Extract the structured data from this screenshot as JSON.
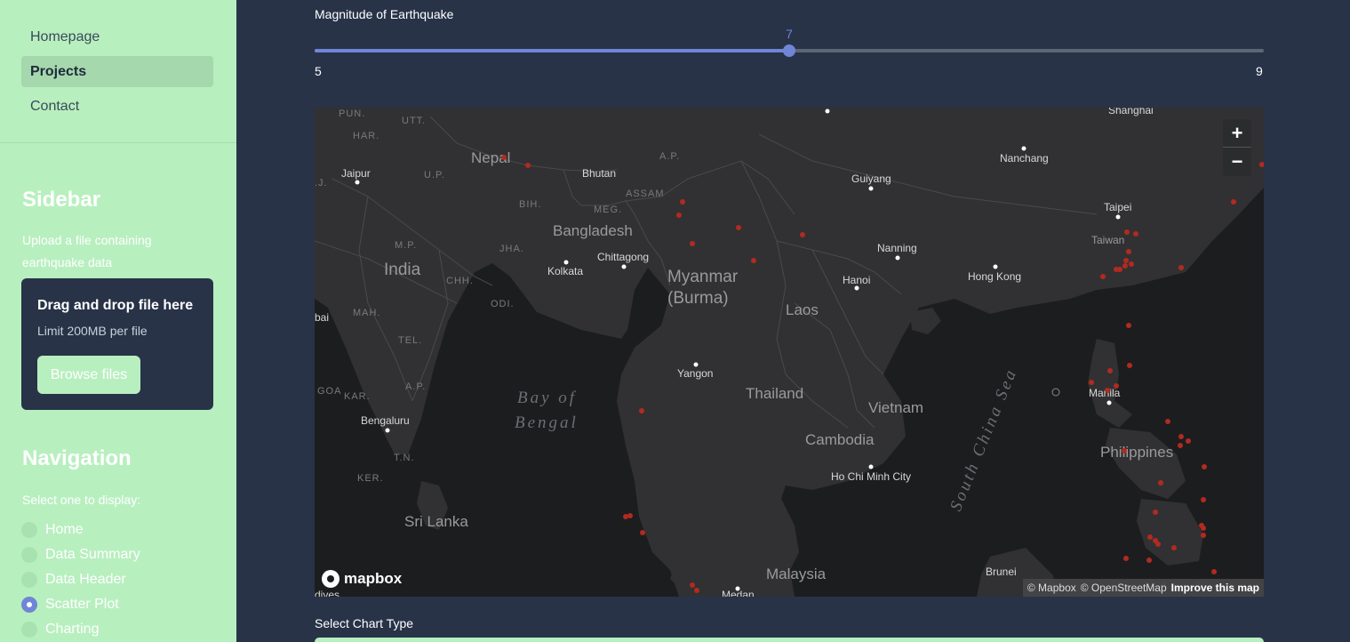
{
  "nav": {
    "items": [
      {
        "label": "Homepage",
        "active": false
      },
      {
        "label": "Projects",
        "active": true
      },
      {
        "label": "Contact",
        "active": false
      }
    ]
  },
  "sidebar": {
    "title": "Sidebar",
    "upload_prompt": "Upload a file containing earthquake data",
    "uploader": {
      "drag_text": "Drag and drop file here",
      "limit_text": "Limit 200MB per file",
      "browse_label": "Browse files"
    },
    "navigation_title": "Navigation",
    "select_prompt": "Select one to display:",
    "options": [
      {
        "label": "Home",
        "selected": false
      },
      {
        "label": "Data Summary",
        "selected": false
      },
      {
        "label": "Data Header",
        "selected": false
      },
      {
        "label": "Scatter Plot",
        "selected": true
      },
      {
        "label": "Charting",
        "selected": false
      }
    ]
  },
  "slider": {
    "label": "Magnitude of Earthquake",
    "min": 5,
    "max": 9,
    "value": 7,
    "min_label": "5",
    "max_label": "9",
    "value_label": "7"
  },
  "map": {
    "zoom_in": "+",
    "zoom_out": "−",
    "logo_text": "mapbox",
    "attribution": {
      "mapbox": "© Mapbox",
      "osm": "© OpenStreetMap",
      "improve": "Improve this map"
    },
    "labels": {
      "countries": [
        "Nepal",
        "Bhutan",
        "Bangladesh",
        "India",
        "Myanmar",
        "(Burma)",
        "Laos",
        "Thailand",
        "Vietnam",
        "Cambodia",
        "Philippines",
        "Sri Lanka",
        "Malaysia",
        "Taiwan"
      ],
      "cities": [
        "Shanghai",
        "Nanchang",
        "Guiyang",
        "Jaipur",
        "Taipei",
        "Nanning",
        "Kolkata",
        "Chittagong",
        "Hong Kong",
        "Hanoi",
        "Yangon",
        "Manila",
        "Bengaluru",
        "Ho Chi Minh City",
        "Brunei",
        "Medan",
        "bai",
        "J.",
        "dives"
      ],
      "regions": [
        "PUN.",
        "UTT.",
        "HAR.",
        "U.P.",
        "A.P.",
        "ASSAM",
        "BIH.",
        "MEG.",
        "M.P.",
        "JHA.",
        "CHH.",
        "MAH.",
        "ODI.",
        "TEL.",
        "GOA",
        "KAR.",
        "A.P.",
        "T.N.",
        "KER."
      ],
      "seas": [
        "Bay of",
        "Bengal",
        "South China Sea"
      ]
    },
    "point_color": "#b22a20"
  },
  "chart_select": {
    "label": "Select Chart Type"
  }
}
